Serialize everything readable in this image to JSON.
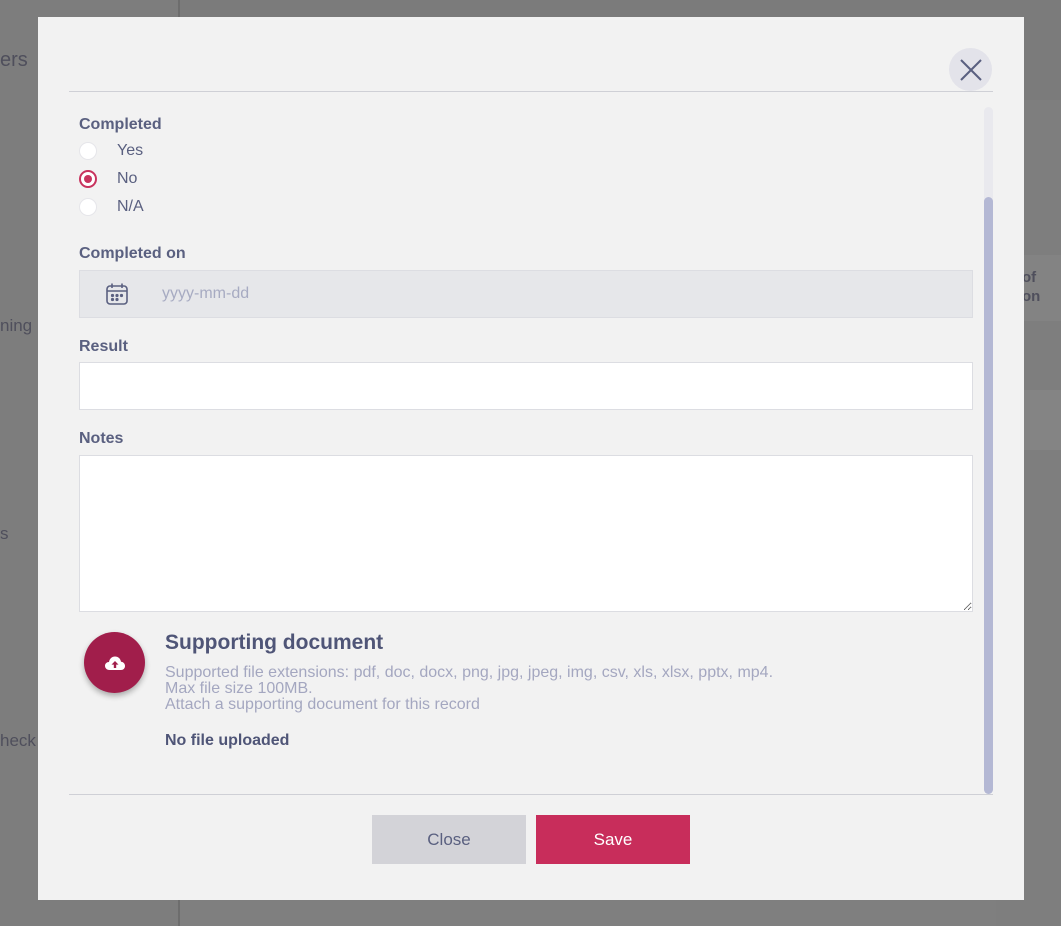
{
  "background": {
    "fragments": [
      "ers",
      "ning",
      "s",
      "heck",
      "of",
      "on"
    ]
  },
  "form": {
    "completed_label": "Completed",
    "completed_options": [
      {
        "label": "Yes",
        "checked": false
      },
      {
        "label": "No",
        "checked": true
      },
      {
        "label": "N/A",
        "checked": false
      }
    ],
    "completed_on_label": "Completed on",
    "completed_on_placeholder": "yyyy-mm-dd",
    "result_label": "Result",
    "notes_label": "Notes"
  },
  "upload": {
    "title": "Supporting document",
    "extensions_text": "Supported file extensions: pdf, doc, docx, png, jpg, jpeg, img, csv, xls, xlsx, pptx, mp4.",
    "max_size_text": "Max file size 100MB.",
    "hint_text": "Attach a supporting document for this record",
    "status_text": "No file uploaded"
  },
  "footer": {
    "close_label": "Close",
    "save_label": "Save"
  },
  "colors": {
    "accent": "#c82d5b",
    "upload_button": "#a11e4b",
    "label_text": "#5a6080"
  },
  "icons": {
    "close": "close-icon",
    "calendar": "calendar-icon",
    "upload": "cloud-upload-icon"
  }
}
